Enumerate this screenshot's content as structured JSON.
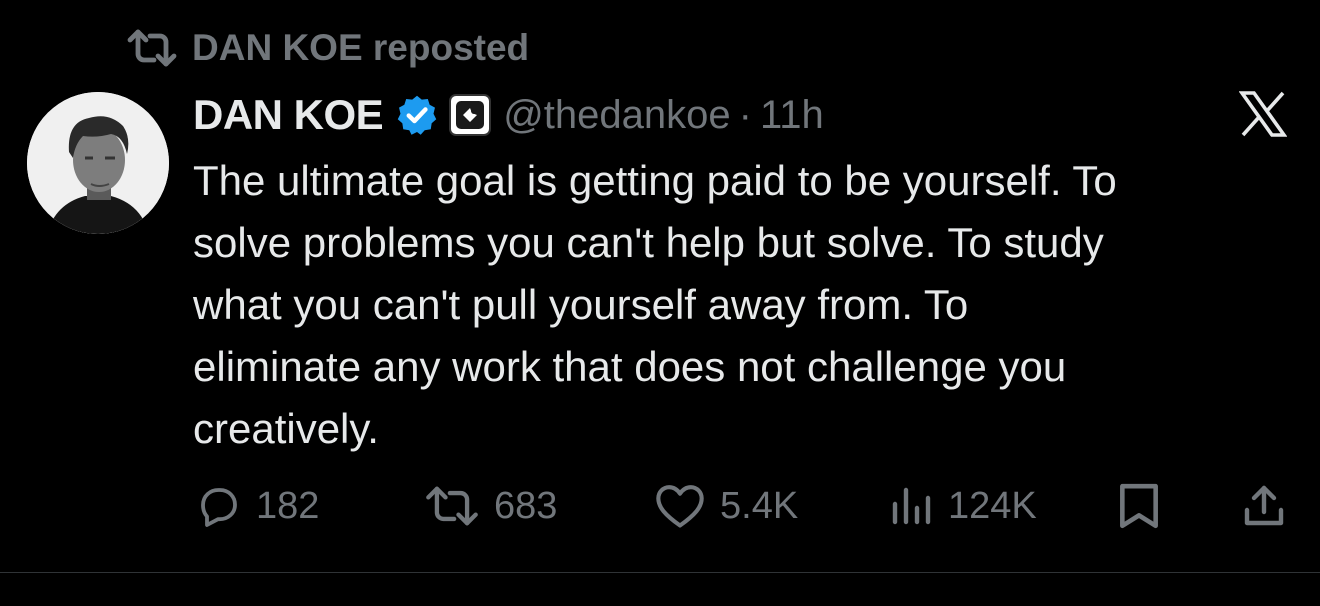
{
  "repost_banner": {
    "text": "DAN KOE reposted",
    "icon": "repost-icon"
  },
  "author": {
    "display_name": "DAN KOE",
    "handle": "@thedankoe",
    "separator": "·",
    "time": "11h",
    "verified_icon": "verified-badge-icon",
    "affiliation_icon": "affiliation-badge-icon",
    "verified_color": "#1d9bf0"
  },
  "platform_logo": "x-logo-icon",
  "tweet_text": "The ultimate goal is getting paid to be yourself. To\nsolve problems you can't help but solve. To study\nwhat you can't pull yourself away from. To\neliminate any work that does not challenge you\ncreatively.",
  "actions": {
    "replies": "182",
    "reposts": "683",
    "likes": "5.4K",
    "views": "124K"
  },
  "colors": {
    "background": "#000000",
    "primary_text": "#e7e9ea",
    "secondary_text": "#71767b"
  }
}
